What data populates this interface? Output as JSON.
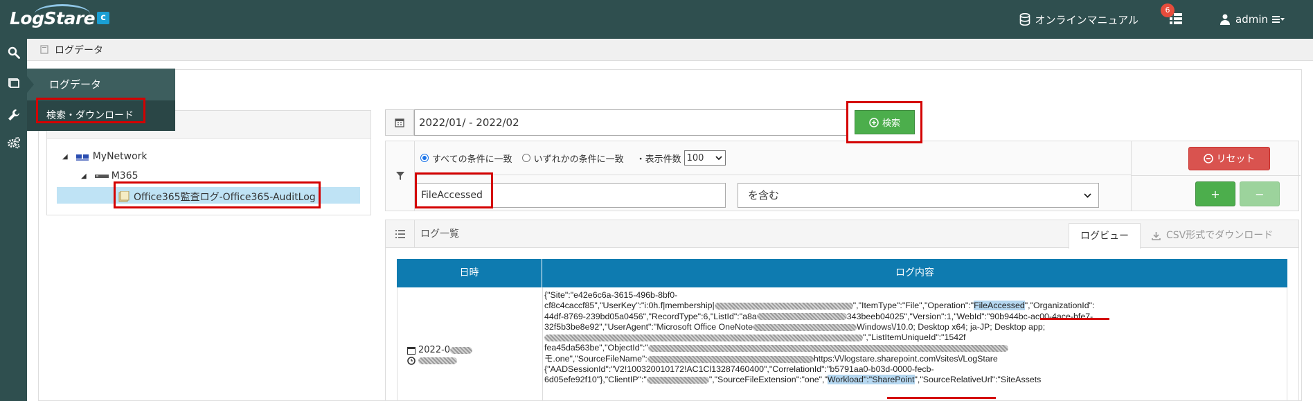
{
  "app": {
    "logo_text": "LogStare",
    "logo_badge": "c"
  },
  "header": {
    "manual_label": "オンラインマニュアル",
    "notification_count": "6",
    "user_label": "admin"
  },
  "breadcrumb": {
    "label": "ログデータ"
  },
  "flyout": {
    "title": "ログデータ",
    "item": "検索・ダウンロード"
  },
  "tree": {
    "network": "MyNetwork",
    "host": "M365",
    "log": "Office365監査ログ-Office365-AuditLog"
  },
  "search": {
    "date_range": "2022/01/                - 2022/02",
    "search_label": "検索"
  },
  "filter": {
    "match_all": "すべての条件に一致",
    "match_any": "いずれかの条件に一致",
    "count_label": "・表示件数",
    "count_value": "100",
    "keyword": "FileAccessed",
    "condition": "を含む",
    "reset_label": "リセット",
    "plus_label": "+",
    "minus_label": "−"
  },
  "log_list": {
    "title": "ログ一覧",
    "tab_view": "ログビュー",
    "tab_csv": "CSV形式でダウンロード",
    "col_date": "日時",
    "col_content": "ログ内容",
    "row_date": "2022-0",
    "log_lines": [
      {
        "pre": "{\"Site\":\"e42e6c6a-3615-496b-8bf0-",
        "hl": "",
        "post": ""
      },
      {
        "pre": "cf8c4caccf85\",\"UserKey\":\"i:0h.f|membership|",
        "hl": "",
        "post": "\",\"ItemType\":\"File\",\"Operation\":\"",
        "hl2": "FileAccessed",
        "post2": "\",\"OrganizationId\":"
      },
      {
        "pre": "44df-8769-239bd05a0456\",\"RecordType\":6,\"ListId\":\"a8a",
        "hl": "",
        "post": "343beeb04025\",\"Version\":1,\"WebId\":\"90b944bc-ac00-4ace-bfe7-"
      },
      {
        "pre": "32f5b3be8e92\",\"UserAgent\":\"Microsoft Office OneNote",
        "hl": "",
        "post": "Windows\\/10.0; Desktop x64; ja-JP; Desktop app;"
      },
      {
        "pre": "",
        "hl": "",
        "post": "\",\"ListItemUniqueId\":\"1542f"
      },
      {
        "pre": "fea45da563be\",\"ObjectId\":\"",
        "hl": "",
        "post": ""
      },
      {
        "pre": "モ.one\",\"SourceFileName\":",
        "hl": "",
        "post": "https:\\/\\/logstare.sharepoint.com\\/sites\\/LogStare"
      },
      {
        "pre": "{\"AADSessionId\":\"V2!100320010172!AC1Cl13287460400\",\"CorrelationId\":\"b5791aa0-b03d-0000-fecb-",
        "hl": "",
        "post": ""
      },
      {
        "pre": "6d05efe92f10\"},\"ClientIP\":\"",
        "hl": "",
        "post": "\",\"SourceFileExtension\":\"one\",\"",
        "hl2": "Workload\":\"SharePoint",
        "post2": "\",\"SourceRelativeUrl\":\"SiteAssets"
      }
    ]
  }
}
